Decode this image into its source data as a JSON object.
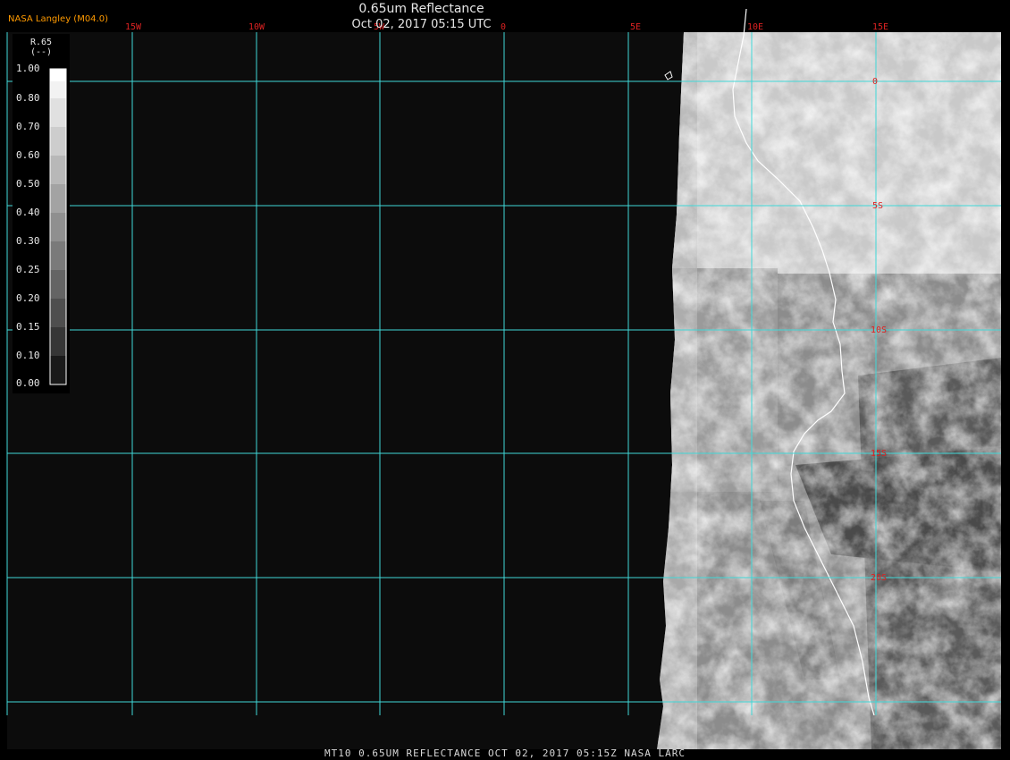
{
  "header": {
    "title": "0.65um Reflectance",
    "datetime": "Oct 02, 2017 05:15 UTC",
    "brand": "NASA Langley (M04.0)"
  },
  "footer": {
    "caption": "MT10  0.65UM REFLECTANCE  OCT 02, 2017 05:15Z  NASA LARC"
  },
  "legend": {
    "title": "R.65",
    "unit": "(--)",
    "labels": [
      "1.00",
      "0.80",
      "0.70",
      "0.60",
      "0.50",
      "0.40",
      "0.30",
      "0.25",
      "0.20",
      "0.15",
      "0.10",
      "0.00"
    ]
  },
  "grid": {
    "lon_labels": [
      "15W",
      "10W",
      "5W",
      "0",
      "5E",
      "10E",
      "15E"
    ],
    "lat_labels": [
      "0",
      "5S",
      "10S",
      "15S",
      "20S"
    ],
    "grid_color": "#40d8d8",
    "label_color": "#d22222"
  }
}
